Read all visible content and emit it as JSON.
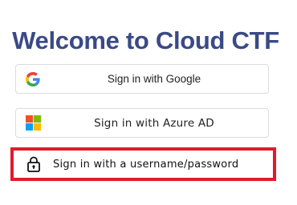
{
  "page": {
    "title": "Welcome to Cloud CTF"
  },
  "login_options": {
    "google": {
      "label": "Sign in with Google",
      "icon": "google-icon"
    },
    "azure": {
      "label": "Sign in with Azure AD",
      "icon": "microsoft-icon"
    },
    "userpass": {
      "label": "Sign in with a username/password",
      "icon": "lock-icon"
    }
  },
  "colors": {
    "title": "#3a4a86",
    "highlight_border": "#e01b2b",
    "button_border": "#dadce0"
  }
}
